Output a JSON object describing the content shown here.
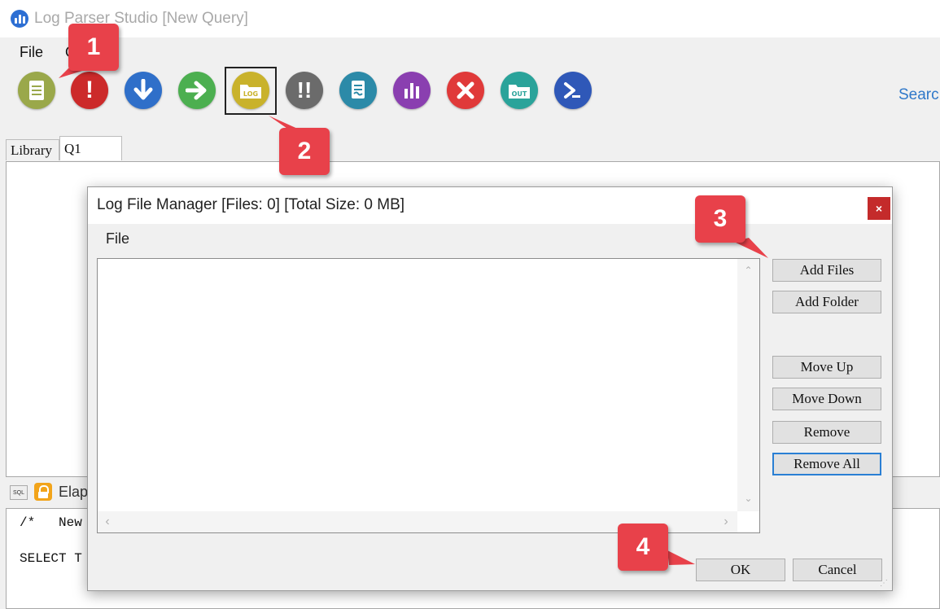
{
  "window": {
    "title": "Log Parser Studio  [New Query]"
  },
  "menubar": {
    "file": "File",
    "second_partial": "O"
  },
  "toolbar": {
    "buttons": [
      {
        "name": "new-query",
        "icon": "document-icon",
        "color": "#9aa84a"
      },
      {
        "name": "run",
        "icon": "exclamation-icon",
        "color": "#cc2a2a"
      },
      {
        "name": "download",
        "icon": "arrow-down-icon",
        "color": "#2f6fc9"
      },
      {
        "name": "next",
        "icon": "arrow-right-icon",
        "color": "#4caf50"
      },
      {
        "name": "log-files",
        "icon": "log-folder-icon",
        "color": "#c9b22b",
        "label": "LOG"
      },
      {
        "name": "run-multiple",
        "icon": "double-exclamation-icon",
        "color": "#6b6b6b"
      },
      {
        "name": "export",
        "icon": "document-scroll-icon",
        "color": "#2c8aa8"
      },
      {
        "name": "chart",
        "icon": "bar-chart-icon",
        "color": "#8a3fb0"
      },
      {
        "name": "stop",
        "icon": "close-icon",
        "color": "#e03a3a"
      },
      {
        "name": "output",
        "icon": "out-folder-icon",
        "color": "#2aa39a",
        "label": "OUT"
      },
      {
        "name": "powershell",
        "icon": "terminal-icon",
        "color": "#2f58b8"
      }
    ],
    "search_partial": "Searc"
  },
  "tabs": {
    "library": "Library",
    "q1": "Q1"
  },
  "status": {
    "sql_icon_text": "SQL",
    "elapsed_partial": "Elap"
  },
  "editor": {
    "line1": "/*   New",
    "line2": "SELECT T"
  },
  "dialog": {
    "title": "Log File Manager [Files: 0] [Total Size: 0 MB]",
    "close": "×",
    "menu_file": "File",
    "buttons": {
      "add_files": "Add Files",
      "add_folder": "Add Folder",
      "move_up": "Move Up",
      "move_down": "Move Down",
      "remove": "Remove",
      "remove_all": "Remove All",
      "ok": "OK",
      "cancel": "Cancel"
    }
  },
  "callouts": {
    "c1": "1",
    "c2": "2",
    "c3": "3",
    "c4": "4"
  }
}
